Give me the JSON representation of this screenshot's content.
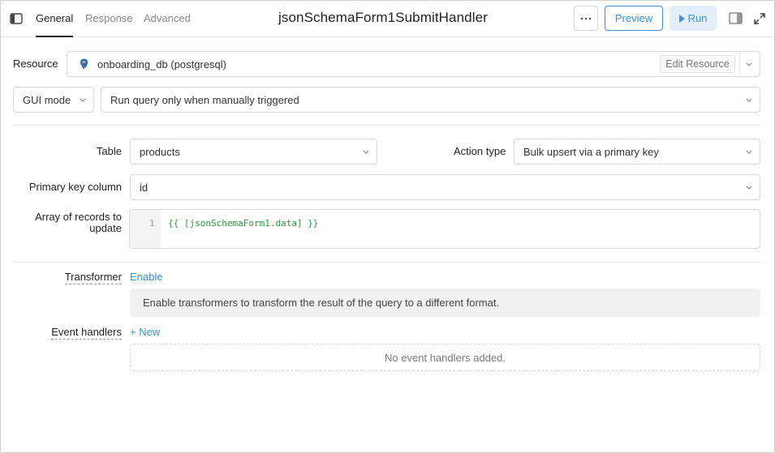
{
  "header": {
    "tabs": [
      {
        "label": "General",
        "active": true
      },
      {
        "label": "Response",
        "active": false
      },
      {
        "label": "Advanced",
        "active": false
      }
    ],
    "title": "jsonSchemaForm1SubmitHandler",
    "more_label": "···",
    "preview_label": "Preview",
    "run_label": "Run"
  },
  "resource": {
    "label": "Resource",
    "value": "onboarding_db (postgresql)",
    "edit_label": "Edit Resource"
  },
  "mode": {
    "mode_value": "GUI mode",
    "trigger_value": "Run query only when manually triggered"
  },
  "table": {
    "label": "Table",
    "value": "products"
  },
  "action_type": {
    "label": "Action type",
    "value": "Bulk upsert via a primary key"
  },
  "primary_key": {
    "label": "Primary key column",
    "value": "id"
  },
  "records": {
    "label_line1": "Array of records to",
    "label_line2": "update",
    "line_number": "1",
    "code": "{{ [jsonSchemaForm1.data] }}"
  },
  "transformer": {
    "label": "Transformer",
    "enable_label": "Enable",
    "info": "Enable transformers to transform the result of the query to a different format."
  },
  "event_handlers": {
    "label": "Event handlers",
    "new_label": "+ New",
    "empty_text": "No event handlers added."
  },
  "colors": {
    "accent": "#3c92dc",
    "code_green": "#2e9a3a"
  }
}
